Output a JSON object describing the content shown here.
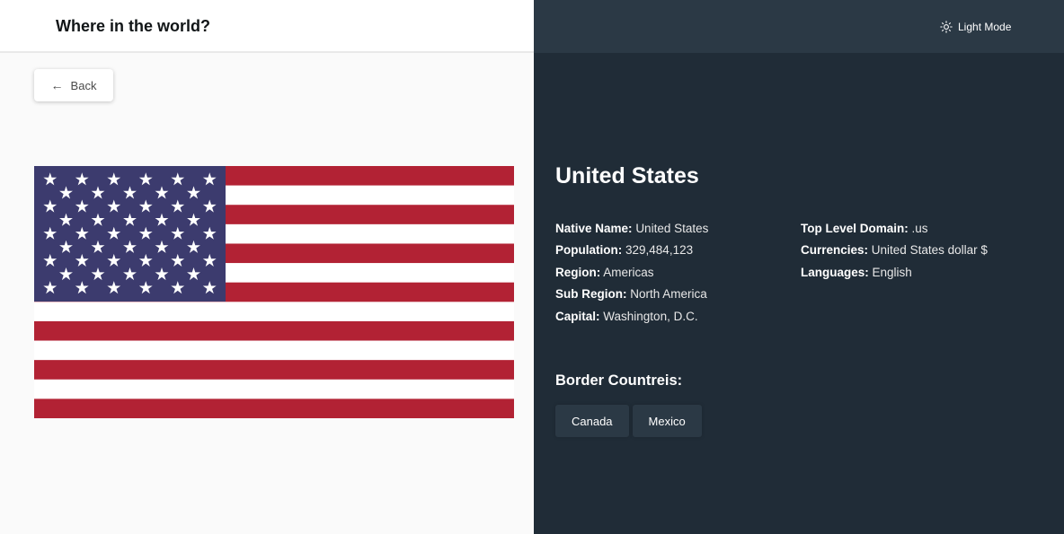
{
  "header": {
    "title": "Where in the world?",
    "mode_toggle_label": "Light Mode",
    "mode_icon": "sun-icon"
  },
  "back_button": {
    "label": "Back",
    "icon": "arrow-left-icon"
  },
  "flag": {
    "alt": "flag of United States",
    "colors": {
      "red": "#b22234",
      "white": "#ffffff",
      "blue": "#3c3b6e"
    }
  },
  "country": {
    "name": "United States",
    "details_left": [
      {
        "label": "Native Name:",
        "value": "United States"
      },
      {
        "label": "Population:",
        "value": "329,484,123"
      },
      {
        "label": "Region:",
        "value": "Americas"
      },
      {
        "label": "Sub Region:",
        "value": "North America"
      },
      {
        "label": "Capital:",
        "value": "Washington, D.C."
      }
    ],
    "details_right": [
      {
        "label": "Top Level Domain:",
        "value": ".us"
      },
      {
        "label": "Currencies:",
        "value": "United States dollar $"
      },
      {
        "label": "Languages:",
        "value": "English"
      }
    ],
    "border_title": "Border Countreis:",
    "borders": [
      "Canada",
      "Mexico"
    ]
  },
  "colors": {
    "dark_background": "#202c37",
    "dark_elements": "#2b3945",
    "light_background": "#fafafa",
    "light_text": "#111517"
  }
}
